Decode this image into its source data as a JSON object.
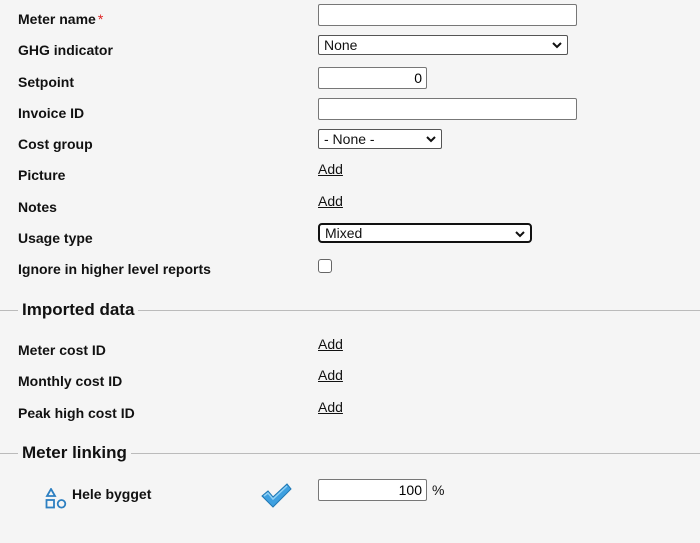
{
  "fields": {
    "meter_name": {
      "label": "Meter name",
      "required_mark": "*",
      "value": ""
    },
    "ghg_indicator": {
      "label": "GHG indicator",
      "selected": "None"
    },
    "setpoint": {
      "label": "Setpoint",
      "value": "0"
    },
    "invoice_id": {
      "label": "Invoice ID",
      "value": ""
    },
    "cost_group": {
      "label": "Cost group",
      "selected": "- None -"
    },
    "picture": {
      "label": "Picture",
      "link": "Add"
    },
    "notes": {
      "label": "Notes",
      "link": "Add"
    },
    "usage_type": {
      "label": "Usage type",
      "selected": "Mixed"
    },
    "ignore_reports": {
      "label": "Ignore in higher level reports",
      "checked": false
    }
  },
  "imported": {
    "title": "Imported data",
    "meter_cost_id": {
      "label": "Meter cost ID",
      "link": "Add"
    },
    "monthly_cost_id": {
      "label": "Monthly cost ID",
      "link": "Add"
    },
    "peak_high_cost_id": {
      "label": "Peak high cost ID",
      "link": "Add"
    }
  },
  "linking": {
    "title": "Meter linking",
    "item": {
      "label": "Hele bygget",
      "value": "100",
      "unit": "%",
      "icon": "shapes-icon",
      "status_icon": "checkmark-icon",
      "icon_color": "#2d7fc1",
      "check_color": "#3ea0e0"
    }
  }
}
